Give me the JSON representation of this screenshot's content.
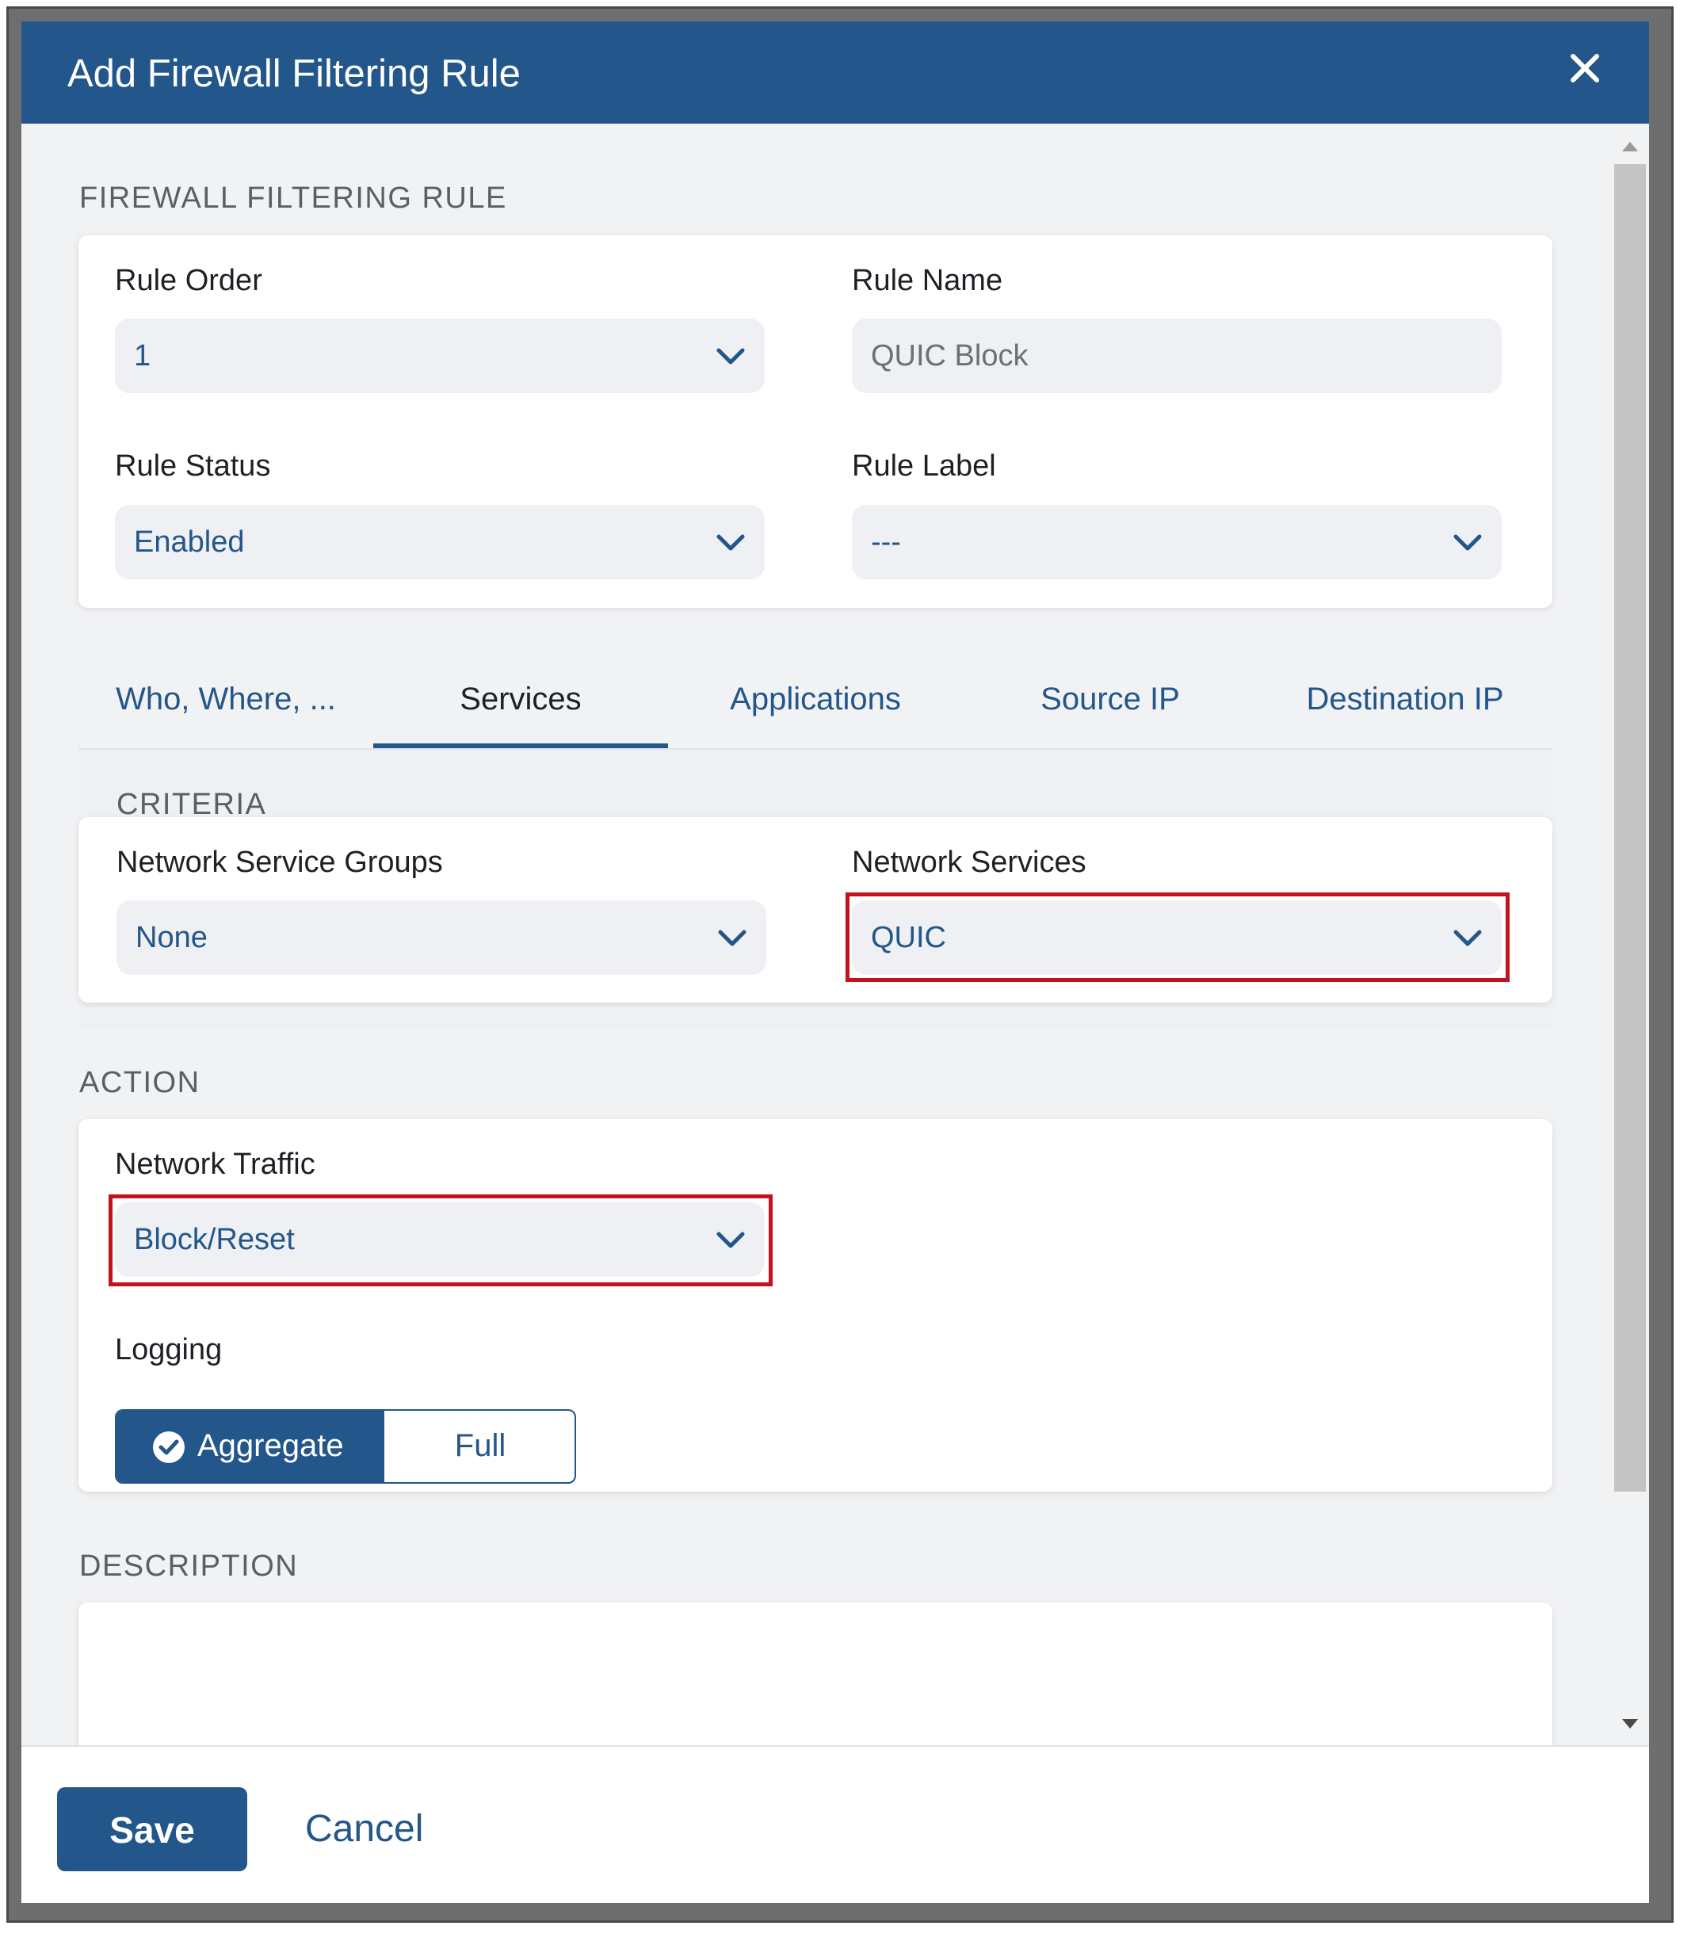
{
  "dialog": {
    "title": "Add Firewall Filtering Rule"
  },
  "rule_section": {
    "label": "FIREWALL FILTERING RULE",
    "rule_order": {
      "label": "Rule Order",
      "value": "1"
    },
    "rule_name": {
      "label": "Rule Name",
      "value": "QUIC Block"
    },
    "rule_status": {
      "label": "Rule Status",
      "value": "Enabled"
    },
    "rule_label": {
      "label": "Rule Label",
      "value": "---"
    }
  },
  "tabs": [
    {
      "label": "Who, Where, ...",
      "active": false
    },
    {
      "label": "Services",
      "active": true
    },
    {
      "label": "Applications",
      "active": false
    },
    {
      "label": "Source IP",
      "active": false
    },
    {
      "label": "Destination IP",
      "active": false
    }
  ],
  "criteria": {
    "label": "CRITERIA",
    "network_service_groups": {
      "label": "Network Service Groups",
      "value": "None"
    },
    "network_services": {
      "label": "Network Services",
      "value": "QUIC"
    }
  },
  "action": {
    "label": "ACTION",
    "network_traffic": {
      "label": "Network Traffic",
      "value": "Block/Reset"
    },
    "logging": {
      "label": "Logging",
      "options": [
        "Aggregate",
        "Full"
      ],
      "selected": "Aggregate"
    }
  },
  "description": {
    "label": "DESCRIPTION",
    "value": ""
  },
  "footer": {
    "save_label": "Save",
    "cancel_label": "Cancel"
  },
  "colors": {
    "header": "#23568a",
    "accent": "#23568a",
    "highlight": "#c2121f",
    "field_bg": "#eef0f3"
  },
  "icons": {
    "close": "close-icon",
    "dropdown": "chevron-down-icon",
    "selected": "check-circle-icon"
  }
}
